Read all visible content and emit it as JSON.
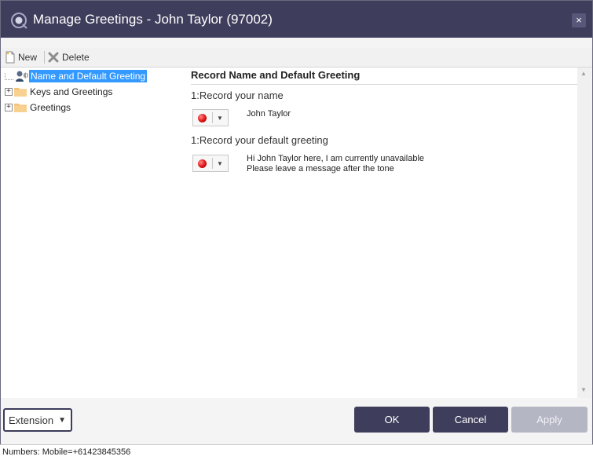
{
  "window": {
    "title": "Manage Greetings - John Taylor (97002)",
    "title_icon": "greeting-app-icon",
    "close_glyph": "×",
    "title_bar_color": "#3e3d5c"
  },
  "toolbar": {
    "new_label": "New",
    "delete_label": "Delete"
  },
  "tree": {
    "items": [
      {
        "label": "Name and Default Greeting",
        "icon": "user-speaker-icon",
        "selected": true
      },
      {
        "label": "Keys and Greetings",
        "icon": "folder-icon",
        "expander": "+"
      },
      {
        "label": "Greetings",
        "icon": "folder-icon",
        "expander": "+"
      }
    ]
  },
  "panel": {
    "title": "Record Name and Default Greeting",
    "sections": [
      {
        "label": "1:Record your name",
        "text_line1": "John Taylor",
        "text_line2": ""
      },
      {
        "label": "1:Record your default greeting",
        "text_line1": "Hi John Taylor here, I am currently unavailable",
        "text_line2": "Please leave a message after the tone"
      }
    ]
  },
  "footer": {
    "select_value": "Extension",
    "ok_label": "OK",
    "cancel_label": "Cancel",
    "apply_label": "Apply",
    "primary_color": "#3e3d5c",
    "disabled_color": "#b4b6c4"
  },
  "status": {
    "text": "Numbers: Mobile=+61423845356"
  }
}
